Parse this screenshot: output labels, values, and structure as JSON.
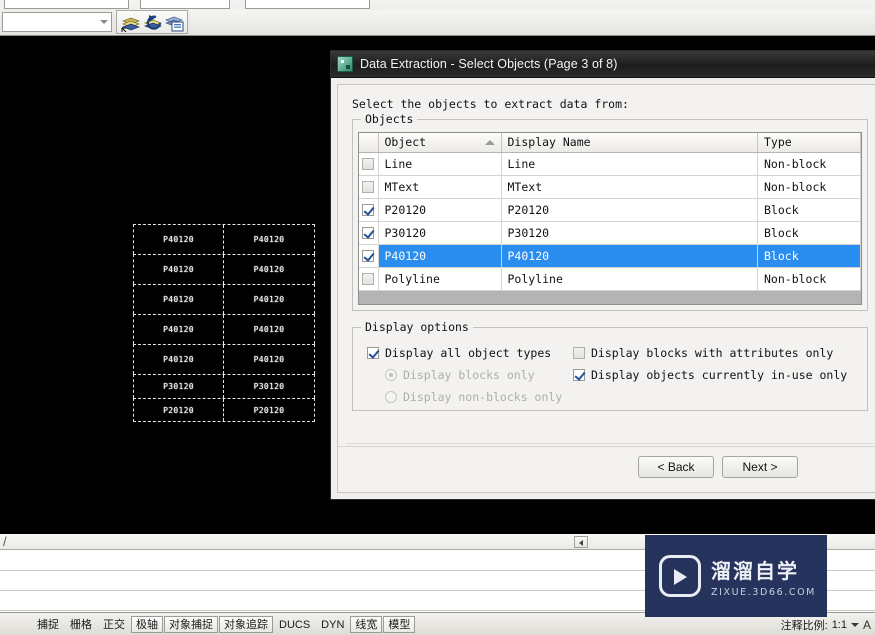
{
  "toolbar": {
    "layer_combo_value": "",
    "icons": [
      {
        "name": "layer-properties-icon",
        "label": "Layer Properties Manager"
      },
      {
        "name": "layer-previous-icon",
        "label": "Layer Previous"
      },
      {
        "name": "layer-states-icon",
        "label": "Layer States Manager"
      }
    ]
  },
  "canvas": {
    "table_rows": [
      {
        "left": "P40120",
        "right": "P40120"
      },
      {
        "left": "P40120",
        "right": "P40120"
      },
      {
        "left": "P40120",
        "right": "P40120"
      },
      {
        "left": "P40120",
        "right": "P40120"
      },
      {
        "left": "P40120",
        "right": "P40120"
      },
      {
        "left": "P30120",
        "right": "P30120"
      },
      {
        "left": "P20120",
        "right": "P20120"
      }
    ]
  },
  "dialog": {
    "title": "Data Extraction - Select Objects (Page 3 of 8)",
    "icon_name": "autocad-data-extraction-icon",
    "prompt": "Select the objects to extract data from:",
    "objects_group_title": "Objects",
    "columns": [
      "Object",
      "Display Name",
      "Type"
    ],
    "sort_column": "Object",
    "sort_direction": "ascending",
    "rows": [
      {
        "checked": false,
        "object": "Line",
        "display_name": "Line",
        "type": "Non-block",
        "selected": false
      },
      {
        "checked": false,
        "object": "MText",
        "display_name": "MText",
        "type": "Non-block",
        "selected": false
      },
      {
        "checked": true,
        "object": "P20120",
        "display_name": "P20120",
        "type": "Block",
        "selected": false
      },
      {
        "checked": true,
        "object": "P30120",
        "display_name": "P30120",
        "type": "Block",
        "selected": false
      },
      {
        "checked": true,
        "object": "P40120",
        "display_name": "P40120",
        "type": "Block",
        "selected": true
      },
      {
        "checked": false,
        "object": "Polyline",
        "display_name": "Polyline",
        "type": "Non-block",
        "selected": false
      }
    ],
    "display_options": {
      "group_title": "Display options",
      "display_all_object_types": {
        "label": "Display all object types",
        "checked": true,
        "enabled": true
      },
      "display_blocks_only": {
        "label": "Display blocks only",
        "selected": true,
        "enabled": false
      },
      "display_non_blocks_only": {
        "label": "Display non-blocks only",
        "selected": false,
        "enabled": false
      },
      "display_blocks_with_attributes_only": {
        "label": "Display blocks with attributes only",
        "checked": false,
        "enabled": true
      },
      "display_objects_currently_in_use_only": {
        "label": "Display objects currently in-use only",
        "checked": true,
        "enabled": true
      }
    },
    "buttons": {
      "back": "< Back",
      "next": "Next >"
    },
    "highlight_color": "#2a8ef0"
  },
  "status_bar": {
    "coordinates": "",
    "toggles": [
      {
        "label": "捕捉",
        "framed": false
      },
      {
        "label": "栅格",
        "framed": false
      },
      {
        "label": "正交",
        "framed": false
      },
      {
        "label": "极轴",
        "framed": true
      },
      {
        "label": "对象捕捉",
        "framed": true
      },
      {
        "label": "对象追踪",
        "framed": true
      },
      {
        "label": "DUCS",
        "framed": false
      },
      {
        "label": "DYN",
        "framed": false
      },
      {
        "label": "线宽",
        "framed": true
      },
      {
        "label": "模型",
        "framed": true
      }
    ],
    "annotation_scale_label": "注释比例:",
    "annotation_scale_value": "1:1",
    "right_icon_name": "annotation-visibility-icon",
    "right_icon_glyph": "A"
  },
  "watermark": {
    "logo_name": "play-button-logo",
    "title_cn": "溜溜自学",
    "url": "ZIXUE.3D66.COM",
    "background": "#26335c"
  }
}
